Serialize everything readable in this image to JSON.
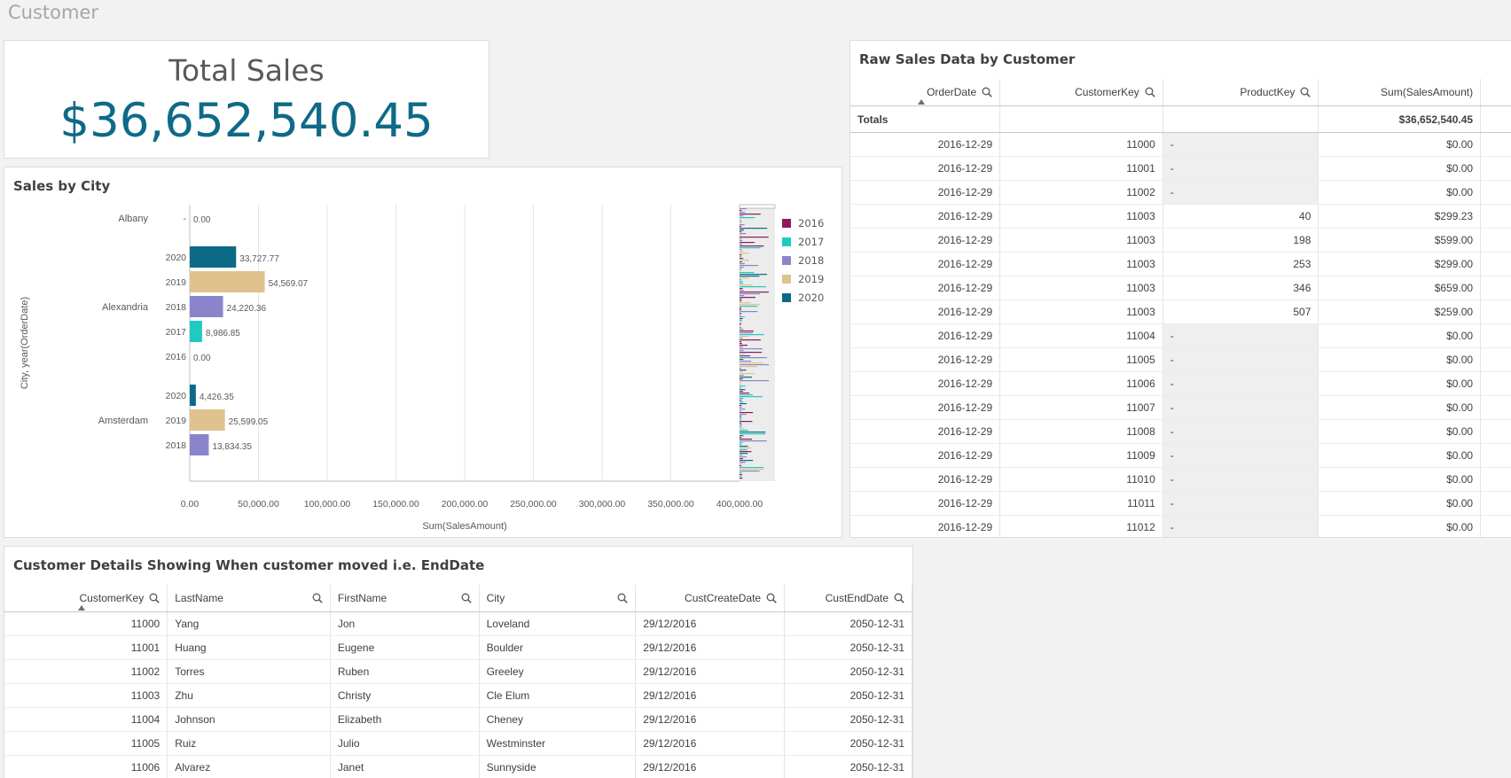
{
  "sheet": {
    "title": "Customer"
  },
  "kpi": {
    "label": "Total Sales",
    "value": "$36,652,540.45"
  },
  "sales_by_city": {
    "title": "Sales by City",
    "ylabel": "City, year(OrderDate)",
    "xlabel": "Sum(SalesAmount)",
    "colors": {
      "2016": "#8e1a5c",
      "2017": "#1fcbc1",
      "2018": "#8a85cb",
      "2019": "#e0c28f",
      "2020": "#0c6a87"
    },
    "legend": [
      "2016",
      "2017",
      "2018",
      "2019",
      "2020"
    ],
    "x_ticks": [
      "0.00",
      "50,000.00",
      "100,000.00",
      "150,000.00",
      "200,000.00",
      "250,000.00",
      "300,000.00",
      "350,000.00",
      "400,000.00"
    ]
  },
  "chart_data": {
    "type": "bar",
    "orientation": "horizontal",
    "title": "Sales by City",
    "xlabel": "Sum(SalesAmount)",
    "ylabel": "City, year(OrderDate)",
    "xlim": [
      0,
      400000
    ],
    "grid": true,
    "legend_position": "right",
    "groups": [
      {
        "city": "Albany",
        "bars": [
          {
            "year": "-",
            "value": 0,
            "label": "0.00"
          }
        ]
      },
      {
        "city": "Alexandria",
        "bars": [
          {
            "year": "2020",
            "value": 33727.77,
            "label": "33,727.77"
          },
          {
            "year": "2019",
            "value": 54569.07,
            "label": "54,569.07"
          },
          {
            "year": "2018",
            "value": 24220.36,
            "label": "24,220.36"
          },
          {
            "year": "2017",
            "value": 8986.85,
            "label": "8,986.85"
          },
          {
            "year": "2016",
            "value": 0,
            "label": "0.00"
          }
        ]
      },
      {
        "city": "Amsterdam",
        "bars": [
          {
            "year": "2020",
            "value": 4426.35,
            "label": "4,426.35"
          },
          {
            "year": "2019",
            "value": 25599.05,
            "label": "25,599.05"
          },
          {
            "year": "2018",
            "value": 13834.35,
            "label": "13,834.35"
          }
        ]
      }
    ]
  },
  "raw_sales": {
    "title": "Raw Sales Data by Customer",
    "columns": [
      "OrderDate",
      "CustomerKey",
      "ProductKey",
      "Sum(SalesAmount)"
    ],
    "totals_label": "Totals",
    "totals_value": "$36,652,540.45",
    "rows": [
      [
        "2016-12-29",
        "11000",
        "-",
        "$0.00"
      ],
      [
        "2016-12-29",
        "11001",
        "-",
        "$0.00"
      ],
      [
        "2016-12-29",
        "11002",
        "-",
        "$0.00"
      ],
      [
        "2016-12-29",
        "11003",
        "40",
        "$299.23"
      ],
      [
        "2016-12-29",
        "11003",
        "198",
        "$599.00"
      ],
      [
        "2016-12-29",
        "11003",
        "253",
        "$299.00"
      ],
      [
        "2016-12-29",
        "11003",
        "346",
        "$659.00"
      ],
      [
        "2016-12-29",
        "11003",
        "507",
        "$259.00"
      ],
      [
        "2016-12-29",
        "11004",
        "-",
        "$0.00"
      ],
      [
        "2016-12-29",
        "11005",
        "-",
        "$0.00"
      ],
      [
        "2016-12-29",
        "11006",
        "-",
        "$0.00"
      ],
      [
        "2016-12-29",
        "11007",
        "-",
        "$0.00"
      ],
      [
        "2016-12-29",
        "11008",
        "-",
        "$0.00"
      ],
      [
        "2016-12-29",
        "11009",
        "-",
        "$0.00"
      ],
      [
        "2016-12-29",
        "11010",
        "-",
        "$0.00"
      ],
      [
        "2016-12-29",
        "11011",
        "-",
        "$0.00"
      ],
      [
        "2016-12-29",
        "11012",
        "-",
        "$0.00"
      ]
    ]
  },
  "customer_details": {
    "title": "Customer Details Showing When customer moved i.e. EndDate",
    "columns": [
      "CustomerKey",
      "LastName",
      "FirstName",
      "City",
      "CustCreateDate",
      "CustEndDate"
    ],
    "rows": [
      [
        "11000",
        "Yang",
        "Jon",
        "Loveland",
        "29/12/2016",
        "2050-12-31"
      ],
      [
        "11001",
        "Huang",
        "Eugene",
        "Boulder",
        "29/12/2016",
        "2050-12-31"
      ],
      [
        "11002",
        "Torres",
        "Ruben",
        "Greeley",
        "29/12/2016",
        "2050-12-31"
      ],
      [
        "11003",
        "Zhu",
        "Christy",
        "Cle Elum",
        "29/12/2016",
        "2050-12-31"
      ],
      [
        "11004",
        "Johnson",
        "Elizabeth",
        "Cheney",
        "29/12/2016",
        "2050-12-31"
      ],
      [
        "11005",
        "Ruiz",
        "Julio",
        "Westminster",
        "29/12/2016",
        "2050-12-31"
      ],
      [
        "11006",
        "Alvarez",
        "Janet",
        "Sunnyside",
        "29/12/2016",
        "2050-12-31"
      ]
    ]
  }
}
